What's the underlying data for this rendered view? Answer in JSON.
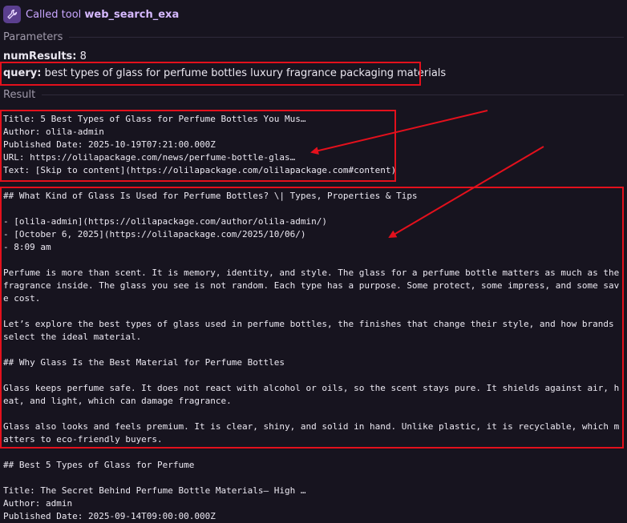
{
  "header": {
    "prefix": "Called tool",
    "tool_name": "web_search_exa",
    "icon": "wrench-icon"
  },
  "parameters": {
    "label": "Parameters",
    "num_results_key": "numResults:",
    "num_results_value": "8",
    "query_key": "query:",
    "query_value": "best types of glass for perfume bottles luxury fragrance packaging materials"
  },
  "result": {
    "label": "Result",
    "lines": [
      "Title: 5 Best Types of Glass for Perfume Bottles You Mus…",
      "Author: olila-admin",
      "Published Date: 2025-10-19T07:21:00.000Z",
      "URL: https://olilapackage.com/news/perfume-bottle-glas…",
      "Text: [Skip to content](https://olilapackage.com/olilapackage.com#content)",
      "",
      "## What Kind of Glass Is Used for Perfume Bottles? \\| Types, Properties & Tips",
      "",
      "- [olila-admin](https://olilapackage.com/author/olila-admin/)",
      "- [October 6, 2025](https://olilapackage.com/2025/10/06/)",
      "- 8:09 am",
      "",
      "Perfume is more than scent. It is memory, identity, and style. The glass for a perfume bottle matters as much as the",
      "fragrance inside. The glass you see is not random. Each type has a purpose. Some protect, some impress, and some sav",
      "e cost.",
      "",
      "Let’s explore the best types of glass used in perfume bottles, the finishes that change their style, and how brands",
      "select the ideal material.",
      "",
      "## Why Glass Is the Best Material for Perfume Bottles",
      "",
      "Glass keeps perfume safe. It does not react with alcohol or oils, so the scent stays pure. It shields against air, h",
      "eat, and light, which can damage fragrance.",
      "",
      "Glass also looks and feels premium. It is clear, shiny, and solid in hand. Unlike plastic, it is recyclable, which m",
      "atters to eco-friendly buyers.",
      "",
      "## Best 5 Types of Glass for Perfume",
      "",
      "Title: The Secret Behind Perfume Bottle Materials– High …",
      "Author: admin",
      "Published Date: 2025-09-14T09:00:00.000Z"
    ]
  },
  "colors": {
    "background": "#17141f",
    "accent": "#c9a6ff",
    "annotation": "#e3101c"
  }
}
